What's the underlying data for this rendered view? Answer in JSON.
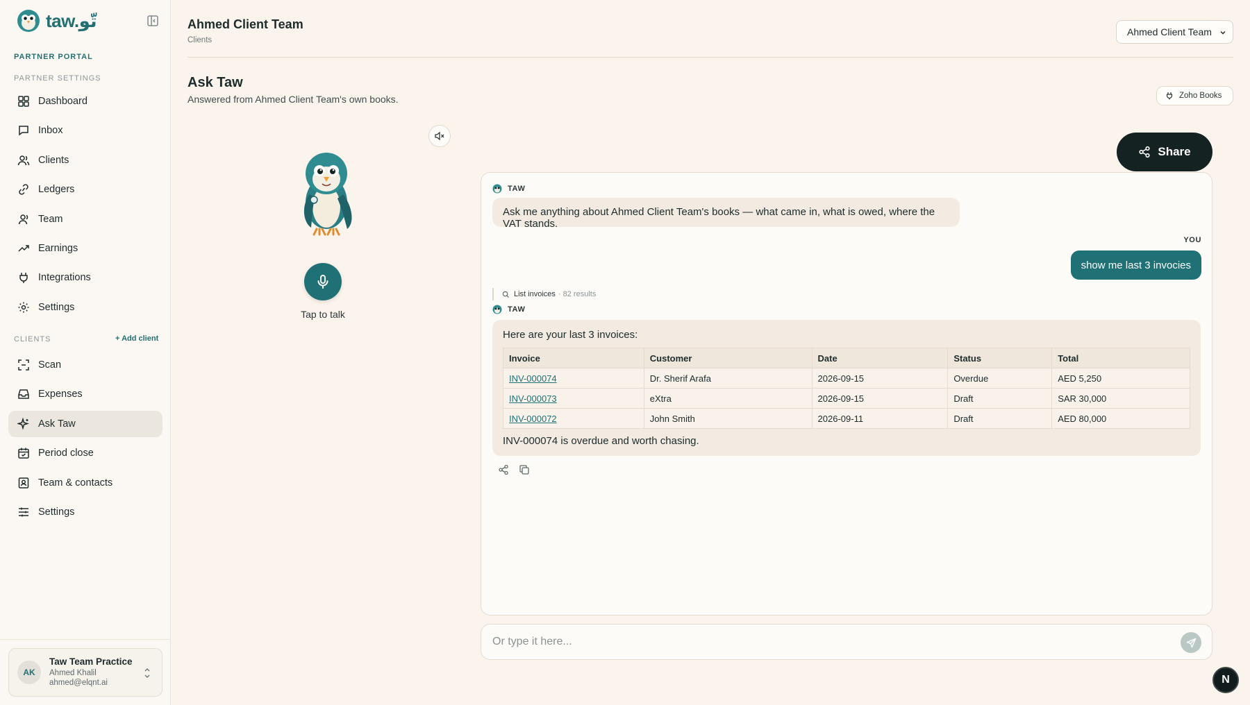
{
  "brand": {
    "name": "taw.تّو",
    "logo_icon": "owl-logo-icon"
  },
  "sidebar": {
    "portal_label": "PARTNER PORTAL",
    "settings_label": "PARTNER SETTINGS",
    "partner_items": [
      {
        "label": "Dashboard",
        "icon": "dashboard-icon"
      },
      {
        "label": "Inbox",
        "icon": "inbox-icon"
      },
      {
        "label": "Clients",
        "icon": "users-icon"
      },
      {
        "label": "Ledgers",
        "icon": "link-icon"
      },
      {
        "label": "Team",
        "icon": "user-icon"
      },
      {
        "label": "Earnings",
        "icon": "trending-up-icon"
      },
      {
        "label": "Integrations",
        "icon": "plug-icon"
      },
      {
        "label": "Settings",
        "icon": "gear-icon"
      }
    ],
    "clients_label": "CLIENTS",
    "add_client": "+ Add client",
    "client_items": [
      {
        "label": "Scan",
        "icon": "scan-icon"
      },
      {
        "label": "Expenses",
        "icon": "tray-icon"
      },
      {
        "label": "Ask Taw",
        "icon": "sparkle-icon",
        "active": true
      },
      {
        "label": "Period close",
        "icon": "calendar-icon"
      },
      {
        "label": "Team & contacts",
        "icon": "contact-icon"
      },
      {
        "label": "Settings",
        "icon": "sliders-icon"
      }
    ],
    "profile": {
      "initials": "AK",
      "org": "Taw Team Practice",
      "name": "Ahmed Khalil",
      "email": "ahmed@elqnt.ai"
    }
  },
  "header": {
    "title": "Ahmed Client Team",
    "breadcrumb": "Clients",
    "team_select": "Ahmed Client Team"
  },
  "ask": {
    "title": "Ask Taw",
    "subtitle": "Answered from Ahmed Client Team's own books.",
    "integration_badge": "Zoho Books",
    "tap_label": "Tap to talk",
    "share_label": "Share"
  },
  "chat": {
    "taw_label": "TAW",
    "you_label": "YOU",
    "intro": "Ask me anything about Ahmed Client Team's books — what came in, what is owed, where the VAT stands.",
    "user_message": "show me last 3 invocies",
    "tool_name": "List invoices",
    "tool_count": "· 82 results",
    "answer_intro": "Here are your last 3 invoices:",
    "table": {
      "headers": [
        "Invoice",
        "Customer",
        "Date",
        "Status",
        "Total"
      ],
      "rows": [
        [
          "INV-000074",
          "Dr. Sherif Arafa",
          "2026-09-15",
          "Overdue",
          "AED 5,250"
        ],
        [
          "INV-000073",
          "eXtra",
          "2026-09-15",
          "Draft",
          "SAR 30,000"
        ],
        [
          "INV-000072",
          "John Smith",
          "2026-09-11",
          "Draft",
          "AED 80,000"
        ]
      ]
    },
    "answer_foot": "INV-000074 is overdue and worth chasing."
  },
  "input": {
    "placeholder": "Or type it here..."
  },
  "badge": "N",
  "colors": {
    "accent": "#1f7176",
    "background": "#faf4ec",
    "share_bg": "#142222"
  }
}
